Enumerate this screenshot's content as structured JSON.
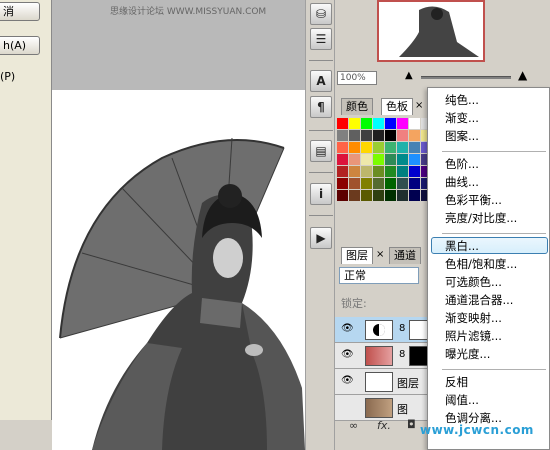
{
  "dialog": {
    "btn_top": "消",
    "btn_auto": "h(A)",
    "link_p": "(P)"
  },
  "canvas": {
    "title": "思缘设计论坛 WWW.MISSYUAN.COM"
  },
  "navigator": {
    "zoom": "100%"
  },
  "swatches": {
    "tabs": [
      "颜色",
      "色板",
      "×"
    ]
  },
  "layers": {
    "tabs": [
      "图层",
      "×",
      "通道"
    ],
    "blend_mode": "正常",
    "lock_label": "锁定:",
    "rows": [
      {
        "name": ""
      },
      {
        "name": ""
      },
      {
        "name": "图层"
      },
      {
        "name": "图"
      }
    ],
    "footer": "fx."
  },
  "menu": {
    "groups": [
      [
        "纯色...",
        "渐变...",
        "图案..."
      ],
      [
        "色阶...",
        "曲线...",
        "色彩平衡...",
        "亮度/对比度..."
      ],
      [
        "黑白...",
        "色相/饱和度...",
        "可选颜色...",
        "通道混合器...",
        "渐变映射...",
        "照片滤镜...",
        "曝光度..."
      ],
      [
        "反相",
        "阈值...",
        "色调分离..."
      ]
    ],
    "highlighted": "黑白..."
  },
  "watermark": "www.jcwcn.com",
  "colors": {
    "menu_highlight_border": "#3c7fb1",
    "selected_layer": "#b6d7f0",
    "nav_border": "#c0504d"
  },
  "icons": [
    "paint-bucket-icon",
    "brush-presets-icon",
    "character-icon",
    "paragraph-icon",
    "layer-comps-icon",
    "info-icon",
    "actions-icon",
    "eye-icon",
    "link-icon",
    "fx-icon",
    "mask-icon",
    "zoom-out-icon",
    "zoom-in-icon"
  ]
}
